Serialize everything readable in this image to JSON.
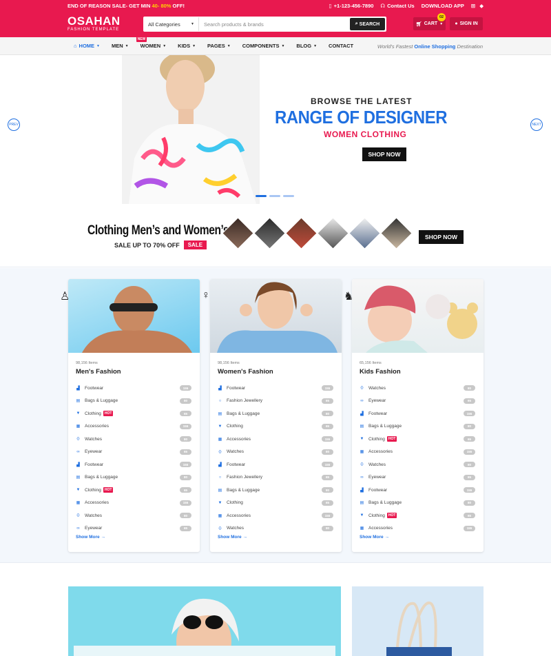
{
  "topbar": {
    "promo_prefix": "END OF REASON SALE- GET MIN ",
    "promo_highlight": "40- 80%",
    "promo_suffix": " OFF!",
    "phone": "+1-123-456-7890",
    "contact": "Contact Us",
    "download": "DOWNLOAD APP"
  },
  "header": {
    "logo": "OSAHAN",
    "logo_sub": "FASHION TEMPLATE",
    "category": "All Categories",
    "search_placeholder": "Search products & brands",
    "search_btn": "SEARCH",
    "cart": "CART",
    "cart_count": "02",
    "signin": "SIGN IN"
  },
  "nav": {
    "items": [
      "HOME",
      "MEN",
      "WOMEN",
      "KIDS",
      "PAGES",
      "COMPONENTS",
      "BLOG",
      "CONTACT"
    ],
    "new_badge": "NEW",
    "tagline_a": "World's Fastest ",
    "tagline_b": "Online Shopping",
    "tagline_c": " Destination"
  },
  "hero": {
    "line1": "BROWSE THE LATEST",
    "line2": "RANGE OF DESIGNER",
    "line3": "WOMEN CLOTHING",
    "cta": "SHOP NOW",
    "prev": "PREV",
    "next": "NEXT"
  },
  "promo": {
    "title": "Clothing Men’s and Women’s",
    "subtitle": "SALE UP TO 70% OFF",
    "sale": "SALE",
    "cta": "SHOP NOW"
  },
  "cards": [
    {
      "count": "98,156 Items",
      "title": "Men's Fashion",
      "more": "Show More",
      "items": [
        {
          "label": "Footwear",
          "num": "155",
          "icon": "shoe"
        },
        {
          "label": "Bags & Luggage",
          "num": "80",
          "icon": "bag"
        },
        {
          "label": "Clothing",
          "num": "65",
          "icon": "shirt",
          "hot": "HOT"
        },
        {
          "label": "Accessories",
          "num": "155",
          "icon": "box"
        },
        {
          "label": "Watches",
          "num": "80",
          "icon": "watch"
        },
        {
          "label": "Eyewear",
          "num": "65",
          "icon": "glasses"
        },
        {
          "label": "Footwear",
          "num": "155",
          "icon": "shoe"
        },
        {
          "label": "Bags & Luggage",
          "num": "80",
          "icon": "bag"
        },
        {
          "label": "Clothing",
          "num": "65",
          "icon": "shirt",
          "hot": "HOT"
        },
        {
          "label": "Accessories",
          "num": "155",
          "icon": "box"
        },
        {
          "label": "Watches",
          "num": "80",
          "icon": "watch"
        },
        {
          "label": "Eyewear",
          "num": "65",
          "icon": "glasses"
        }
      ]
    },
    {
      "count": "98,156 Items",
      "title": "Women's Fashion",
      "more": "Show More",
      "items": [
        {
          "label": "Footwear",
          "num": "155",
          "icon": "shoe"
        },
        {
          "label": "Fashion Jewellery",
          "num": "65",
          "icon": "ring"
        },
        {
          "label": "Bags & Luggage",
          "num": "80",
          "icon": "bag"
        },
        {
          "label": "Clothing",
          "num": "65",
          "icon": "shirt"
        },
        {
          "label": "Accessories",
          "num": "155",
          "icon": "box"
        },
        {
          "label": "Watches",
          "num": "80",
          "icon": "watch"
        },
        {
          "label": "Footwear",
          "num": "155",
          "icon": "shoe"
        },
        {
          "label": "Fashion Jewellery",
          "num": "65",
          "icon": "ring"
        },
        {
          "label": "Bags & Luggage",
          "num": "80",
          "icon": "bag"
        },
        {
          "label": "Clothing",
          "num": "65",
          "icon": "shirt"
        },
        {
          "label": "Accessories",
          "num": "155",
          "icon": "box"
        },
        {
          "label": "Watches",
          "num": "80",
          "icon": "watch"
        }
      ]
    },
    {
      "count": "65,156 Items",
      "title": "Kids Fashion",
      "more": "Show More",
      "items": [
        {
          "label": "Watches",
          "num": "80",
          "icon": "watch"
        },
        {
          "label": "Eyewear",
          "num": "65",
          "icon": "glasses"
        },
        {
          "label": "Footwear",
          "num": "155",
          "icon": "shoe"
        },
        {
          "label": "Bags & Luggage",
          "num": "80",
          "icon": "bag"
        },
        {
          "label": "Clothing",
          "num": "65",
          "icon": "shirt",
          "hot": "HOT"
        },
        {
          "label": "Accessories",
          "num": "155",
          "icon": "box"
        },
        {
          "label": "Watches",
          "num": "80",
          "icon": "watch"
        },
        {
          "label": "Eyewear",
          "num": "65",
          "icon": "glasses"
        },
        {
          "label": "Footwear",
          "num": "155",
          "icon": "shoe"
        },
        {
          "label": "Bags & Luggage",
          "num": "80",
          "icon": "bag"
        },
        {
          "label": "Clothing",
          "num": "65",
          "icon": "shirt",
          "hot": "HOT"
        },
        {
          "label": "Accessories",
          "num": "155",
          "icon": "box"
        }
      ]
    }
  ],
  "colors": {
    "primary": "#e8194f",
    "accent": "#1f6fe0",
    "dark": "#111111",
    "hot": "#e8194f"
  }
}
